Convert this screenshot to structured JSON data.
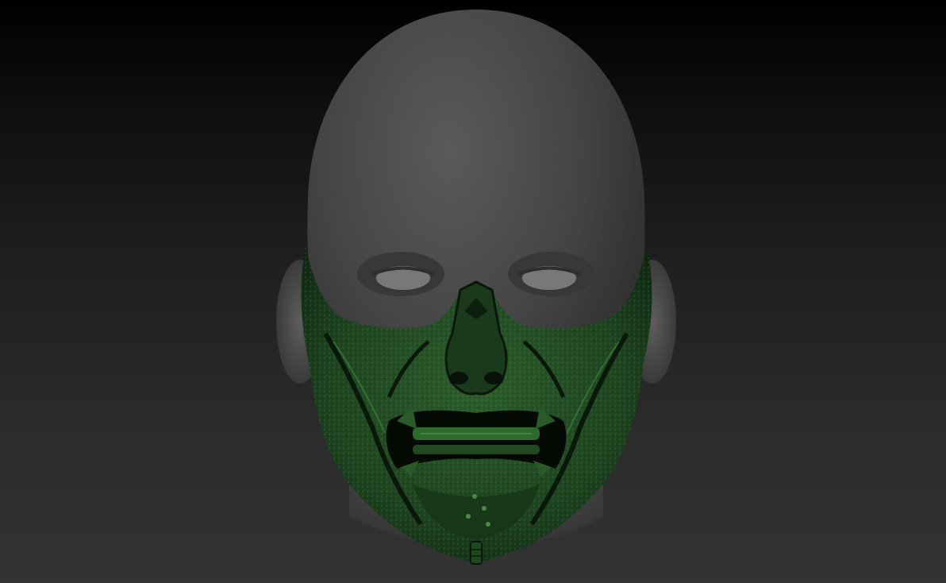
{
  "viewport": {
    "background_top": "#000000",
    "background_bottom": "#333333"
  },
  "model": {
    "head_color": "#4a4a4a",
    "mask_color": "#1f4a22",
    "mask_highlight": "#3f8a3c",
    "mask_shadow": "#0b1c0c",
    "eye_color": "#7a7a7a"
  }
}
